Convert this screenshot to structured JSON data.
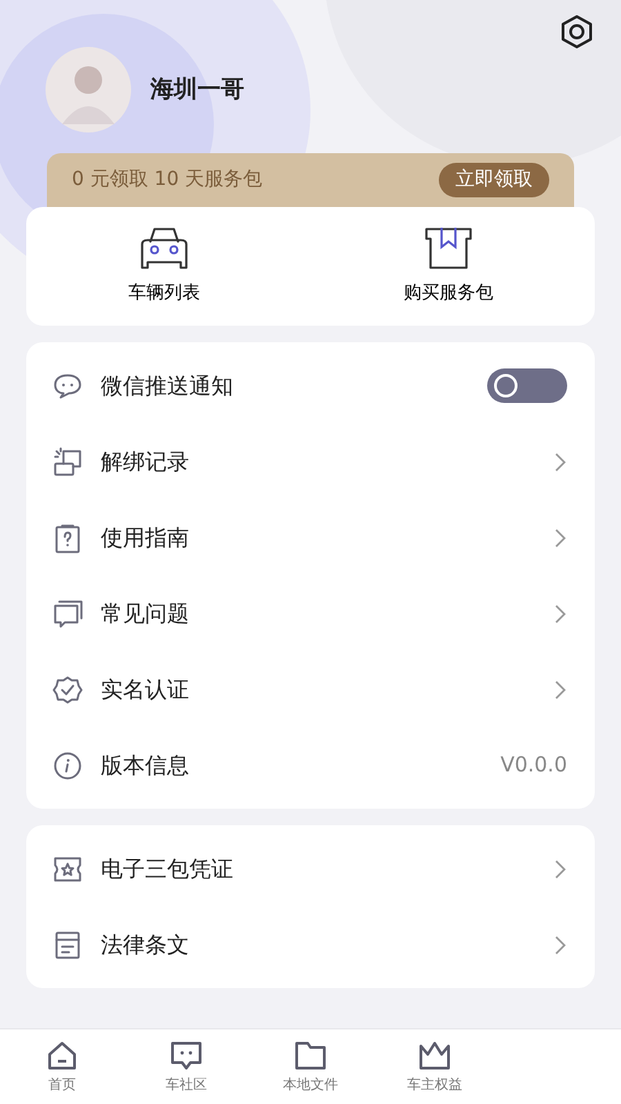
{
  "profile": {
    "name": "海圳一哥"
  },
  "promo": {
    "text": "0 元领取 10 天服务包",
    "button": "立即领取"
  },
  "shortcuts": [
    {
      "kind": "car",
      "label": "车辆列表"
    },
    {
      "kind": "package",
      "label": "购买服务包"
    }
  ],
  "menu": [
    {
      "kind": "toggle",
      "label": "微信推送通知",
      "on": false
    },
    {
      "kind": "link",
      "label": "解绑记录"
    },
    {
      "kind": "link",
      "label": "使用指南"
    },
    {
      "kind": "link",
      "label": "常见问题"
    },
    {
      "kind": "link",
      "label": "实名认证"
    },
    {
      "kind": "value",
      "label": "版本信息",
      "value": "V0.0.0"
    }
  ],
  "menu2": [
    {
      "kind": "link",
      "label": "电子三包凭证"
    },
    {
      "kind": "link",
      "label": "法律条文"
    }
  ],
  "tabs": [
    {
      "label": "首页",
      "selected": false
    },
    {
      "label": "车社区",
      "selected": false
    },
    {
      "label": "本地文件",
      "selected": false
    },
    {
      "label": "车主权益",
      "selected": false
    }
  ]
}
